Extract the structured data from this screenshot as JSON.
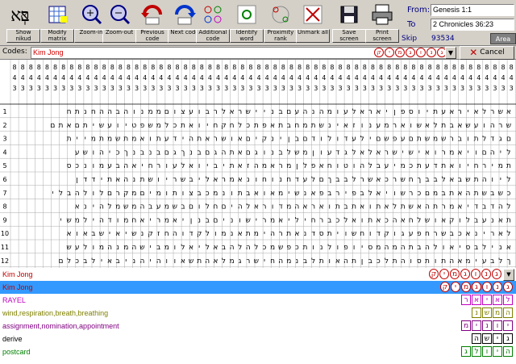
{
  "toolbar": {
    "buttons": [
      {
        "label": "Show nikud",
        "icon": "hebrew-letters-icon"
      },
      {
        "label": "Modify matrix",
        "icon": "grid-matrix-icon"
      },
      {
        "label": "Zoom-in",
        "icon": "zoom-in-icon"
      },
      {
        "label": "Zoom-out",
        "icon": "zoom-out-icon"
      },
      {
        "label": "Previous code",
        "icon": "previous-arrow-icon"
      },
      {
        "label": "Next code",
        "icon": "next-arrow-icon"
      },
      {
        "label": "Additional code",
        "icon": "additional-code-icon"
      },
      {
        "label": "Identify word",
        "icon": "identify-word-icon"
      },
      {
        "label": "Proximity rank",
        "icon": "proximity-icon"
      },
      {
        "label": "Unmark all",
        "icon": "unmark-icon"
      },
      {
        "label": "Save screen",
        "icon": "floppy-disk-icon"
      },
      {
        "label": "Print screen",
        "icon": "printer-icon"
      }
    ],
    "logo_text": "בְּא",
    "from_label": "From:",
    "from_value": "Genesis 1:1",
    "to_label": "To",
    "to_value": "2 Chronicles 36:23",
    "skip_label": "Skip",
    "skip_value": "93534",
    "area_label": "Area"
  },
  "codes": {
    "label": "Codes:",
    "value": "Kim Jong",
    "cancel_label": "Cancel",
    "hebrew_letters": [
      "ק",
      "י",
      "מ",
      "ג",
      "ו",
      "נ",
      "ג"
    ]
  },
  "grid": {
    "header_columns": [
      "843",
      "843",
      "843",
      "843",
      "843",
      "843",
      "843",
      "843",
      "843",
      "843",
      "843",
      "843",
      "843",
      "843",
      "843",
      "843",
      "843",
      "843",
      "843",
      "843",
      "843",
      "843",
      "843",
      "843",
      "843",
      "843",
      "843",
      "843",
      "843",
      "843",
      "843",
      "843",
      "843",
      "843",
      "843",
      "843",
      "843",
      "843",
      "843",
      "843",
      "843",
      "843",
      "843",
      "843",
      "843",
      "843",
      "843",
      "843",
      "843",
      "843",
      "843",
      "843",
      "843",
      "843",
      "843",
      "843",
      "843",
      "843",
      "843",
      "843",
      "843",
      "843"
    ],
    "row_numbers": [
      "1",
      "2",
      "3",
      "4",
      "5",
      "6",
      "7",
      "8",
      "9",
      "10",
      "11",
      "12"
    ],
    "rows": [
      "אשרלאיראעתיוספןיאראלעומהנהעםבניישראלרבועצוםממנוהבההחנתח",
      "שרהועשאבתלאשוארמענוזאינשתמחבתאפתכלחקחיואתכלמשפטיועשיתםאתם",
      "םגדלתוברשמשתםעפשםילעדולודםבןינקיםאושראתהידעתואמתשמתמיית",
      "ליהםויאמרואישישראלאלגדעוןמשלבנוגםאתהגםבנךגםבנבנךכיהושע",
      "תמירחיואתדעתכמיעבלהוטוחאפלןמראמהזאתיביואלעורחיאהבעמונכס",
      "ליוהתשבאלבבךחשרכאשרלבבךםלעדחנוחונאמראליבשריושתנהאתידדן",
      "כשבשתהאתבמםכרשויאלבפירבפאנשימאואבתונמכבצותומיםמקרםלולהבלי",
      "להדבדיאמרתהאשתלאתואתבתואראהמדוראלהיםחלוםבשמעבהמשמלהינא",
      "תאנעבלוקאושלחאהכאתואלכברחיליאמרישוניםבנןיאמריאחמודהילמשי",
      "לארינאכבשרחפעגוקדוחשויתסדנאתרהימתאנמולקדוהחזקנשיאישבאוא",
      "אנילבסיאולהבתהמהמסיופולנותכפשמכלהלהבאליאלומבישהמנהמולעש",
      "ךלבעימאהתותסוהתלכבןתהאותלבנמהחישרגמלאהתשאווהיהניבאילבכלם"
    ]
  },
  "results": [
    {
      "text": "Kim Jong",
      "color": "#c00000",
      "letters": [
        "ק",
        "י",
        "מ",
        "ג",
        "ו",
        "נ",
        "ג"
      ],
      "selected": false
    },
    {
      "text": "Kim Jong",
      "color": "#c00000",
      "letters": [
        "ק",
        "י",
        "מ",
        "ג",
        "ו",
        "נ",
        "ג"
      ],
      "selected": true
    },
    {
      "text": "RAYEL",
      "color": "#c000c0",
      "letters": [
        "ר",
        "א",
        "י",
        "א",
        "ל"
      ],
      "selected": false
    },
    {
      "text": "wind,respiration,breath,breathing",
      "color": "#808000",
      "letters": [
        "נ",
        "ש",
        "מ",
        "ה"
      ],
      "selected": false
    },
    {
      "text": "assignment,nomination,appointment",
      "color": "#800080",
      "letters": [
        "מ",
        "י",
        "נ",
        "ו",
        "י"
      ],
      "selected": false
    },
    {
      "text": "derive",
      "color": "#000000",
      "letters": [
        "ה",
        "ש",
        "י",
        "ג"
      ],
      "selected": false
    },
    {
      "text": "postcard",
      "color": "#008000",
      "letters": [
        "ג",
        "ל",
        "ו",
        "י",
        "ה"
      ],
      "selected": false
    }
  ],
  "colors": {
    "toolbar_bg": "#d4d0c8",
    "selected_row_bg": "#3399ff",
    "code_red": "#c00000"
  }
}
